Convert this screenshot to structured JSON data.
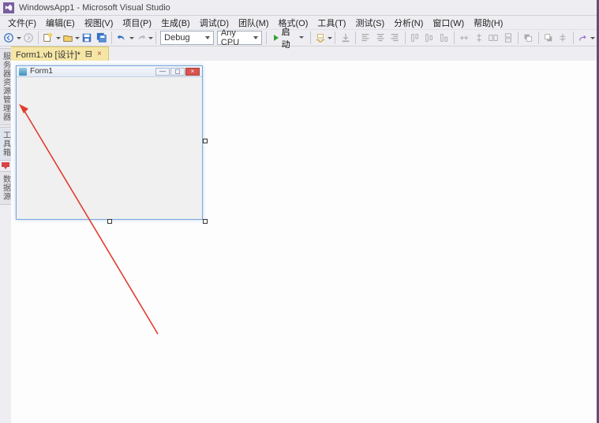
{
  "titlebar": {
    "title": "WindowsApp1 - Microsoft Visual Studio"
  },
  "menu": {
    "file": "文件(F)",
    "edit": "编辑(E)",
    "view": "视图(V)",
    "project": "项目(P)",
    "build": "生成(B)",
    "debug": "调试(D)",
    "team": "团队(M)",
    "format": "格式(O)",
    "tools": "工具(T)",
    "test": "测试(S)",
    "analyze": "分析(N)",
    "window": "窗口(W)",
    "help": "帮助(H)"
  },
  "toolbar": {
    "config": "Debug",
    "platform": "Any CPU",
    "run": "启动"
  },
  "sidetabs": {
    "server": "服务器资源管理器",
    "toolbox": "工具箱",
    "datasource": "数据源"
  },
  "tab": {
    "label": "Form1.vb [设计]*",
    "pin": "⊟",
    "close": "×"
  },
  "form": {
    "title": "Form1",
    "min": "—",
    "max": "▢",
    "close": "×"
  }
}
